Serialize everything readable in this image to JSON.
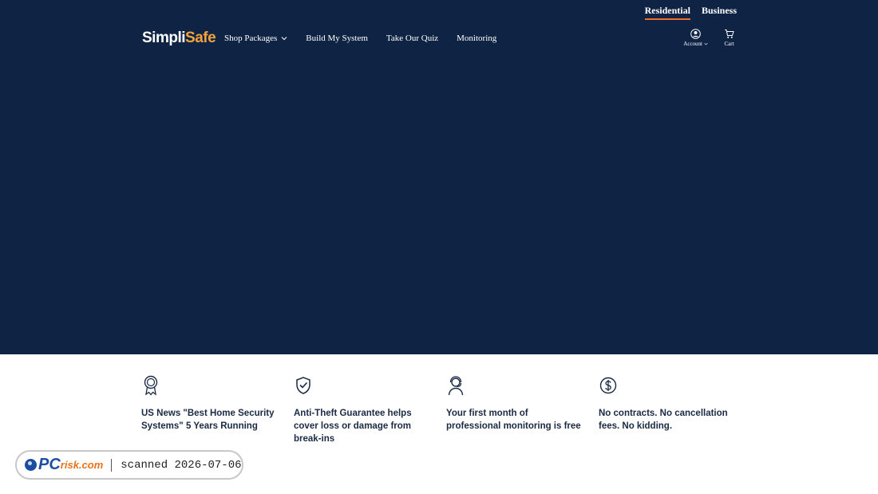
{
  "utility_nav": [
    {
      "label": "Residential",
      "active": true
    },
    {
      "label": "Business",
      "active": false
    }
  ],
  "logo": {
    "part1": "Simpli",
    "part2": "Safe"
  },
  "main_nav": [
    {
      "label": "Shop Packages",
      "has_dropdown": true
    },
    {
      "label": "Build My System",
      "has_dropdown": false
    },
    {
      "label": "Take Our Quiz",
      "has_dropdown": false
    },
    {
      "label": "Monitoring",
      "has_dropdown": false
    }
  ],
  "user_tools": {
    "account_label": "Account",
    "cart_label": "Cart"
  },
  "features": [
    {
      "icon": "award-ribbon-icon",
      "text": "US News \"Best Home Security Systems\" 5 Years Running"
    },
    {
      "icon": "shield-check-icon",
      "text": "Anti-Theft Guarantee helps cover loss or damage from break-ins"
    },
    {
      "icon": "support-agent-icon",
      "text": "Your first month of professional monitoring is free"
    },
    {
      "icon": "dollar-circle-icon",
      "text": "No contracts. No cancellation fees. No kidding."
    }
  ],
  "watermark": {
    "brand_a": "PC",
    "brand_b": "risk.com",
    "scan_text": "scanned 2026-07-06"
  },
  "colors": {
    "hero_bg": "#0f2445",
    "accent_orange": "#f26c2a",
    "logo_safe": "#f2a33c"
  }
}
